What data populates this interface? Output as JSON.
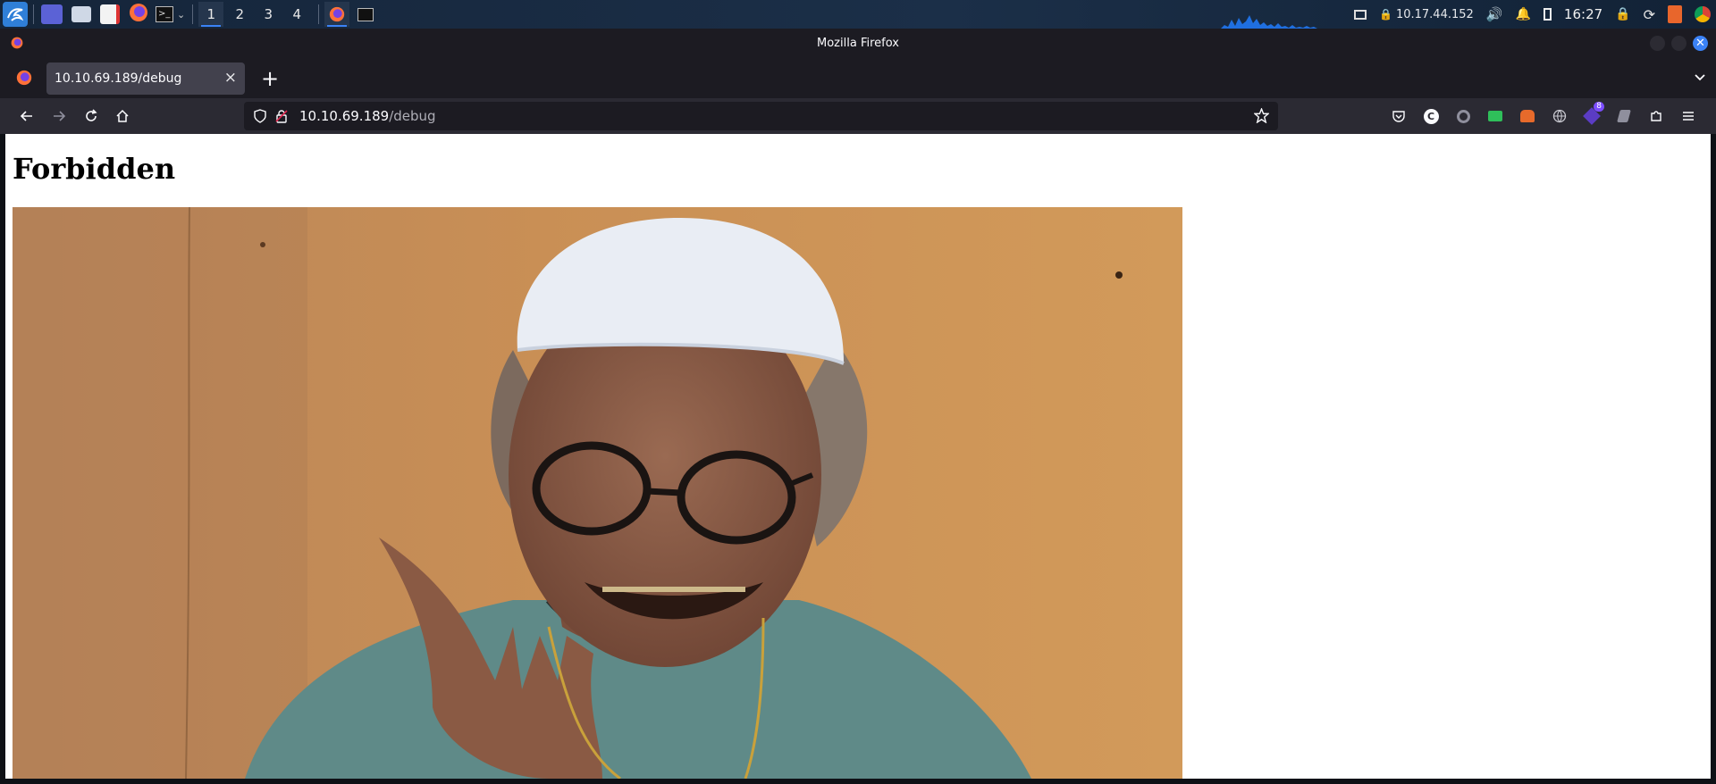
{
  "panel": {
    "workspaces": [
      "1",
      "2",
      "3",
      "4"
    ],
    "active_workspace": "1",
    "tray": {
      "ip_address": "10.17.44.152",
      "clock": "16:27"
    }
  },
  "browser": {
    "window_title": "Mozilla Firefox",
    "tab": {
      "title": "10.10.69.189/debug",
      "close": "×"
    },
    "new_tab": "+",
    "url": {
      "host": "10.10.69.189",
      "path": "/debug"
    },
    "extension_badge": "8"
  },
  "page": {
    "heading": "Forbidden",
    "image": {
      "subject": "man-in-white-cap-and-glasses-laughing-against-orange-wall",
      "colors": {
        "wall": "#c98f55",
        "cap": "#e9edf4",
        "shirt": "#5f8a88",
        "skin": "#8a5a44"
      }
    }
  },
  "colors": {
    "accent": "#3b82f6",
    "panel_bg": "#15253a",
    "chrome_bg": "#1c1b22",
    "navbar_bg": "#2b2a33",
    "tab_active": "#42414d"
  }
}
